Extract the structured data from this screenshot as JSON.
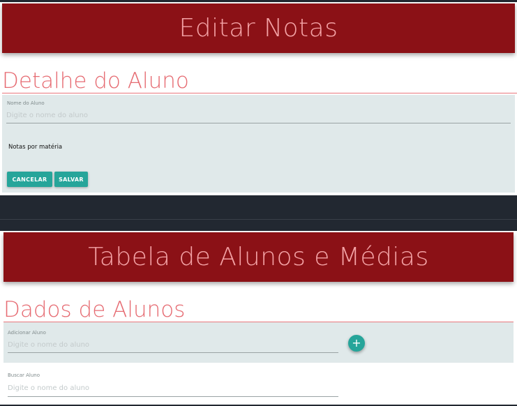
{
  "edit_section": {
    "banner_title": "Editar Notas",
    "section_title": "Detalhe do Aluno",
    "name_field": {
      "label": "Nome do Aluno",
      "placeholder": "Digite o nome do aluno",
      "value": ""
    },
    "notes_label": "Notas por matéria",
    "cancel_label": "CANCELAR",
    "save_label": "SALVAR"
  },
  "table_section": {
    "banner_title": "Tabela de Alunos e Médias",
    "section_title": "Dados de Alunos",
    "add_field": {
      "label": "Adicionar Aluno",
      "placeholder": "Digite o nome do aluno",
      "value": ""
    },
    "add_button_icon": "plus-icon",
    "add_button_glyph": "+",
    "search_field": {
      "label": "Buscar Aluno",
      "placeholder": "Digite o nome do aluno",
      "value": ""
    }
  },
  "colors": {
    "banner_bg": "#8b1116",
    "banner_text": "#f4a3a6",
    "section_title": "#e66b72",
    "panel_bg": "#e0e9ea",
    "accent": "#26a59a",
    "dark_band": "#222831"
  }
}
